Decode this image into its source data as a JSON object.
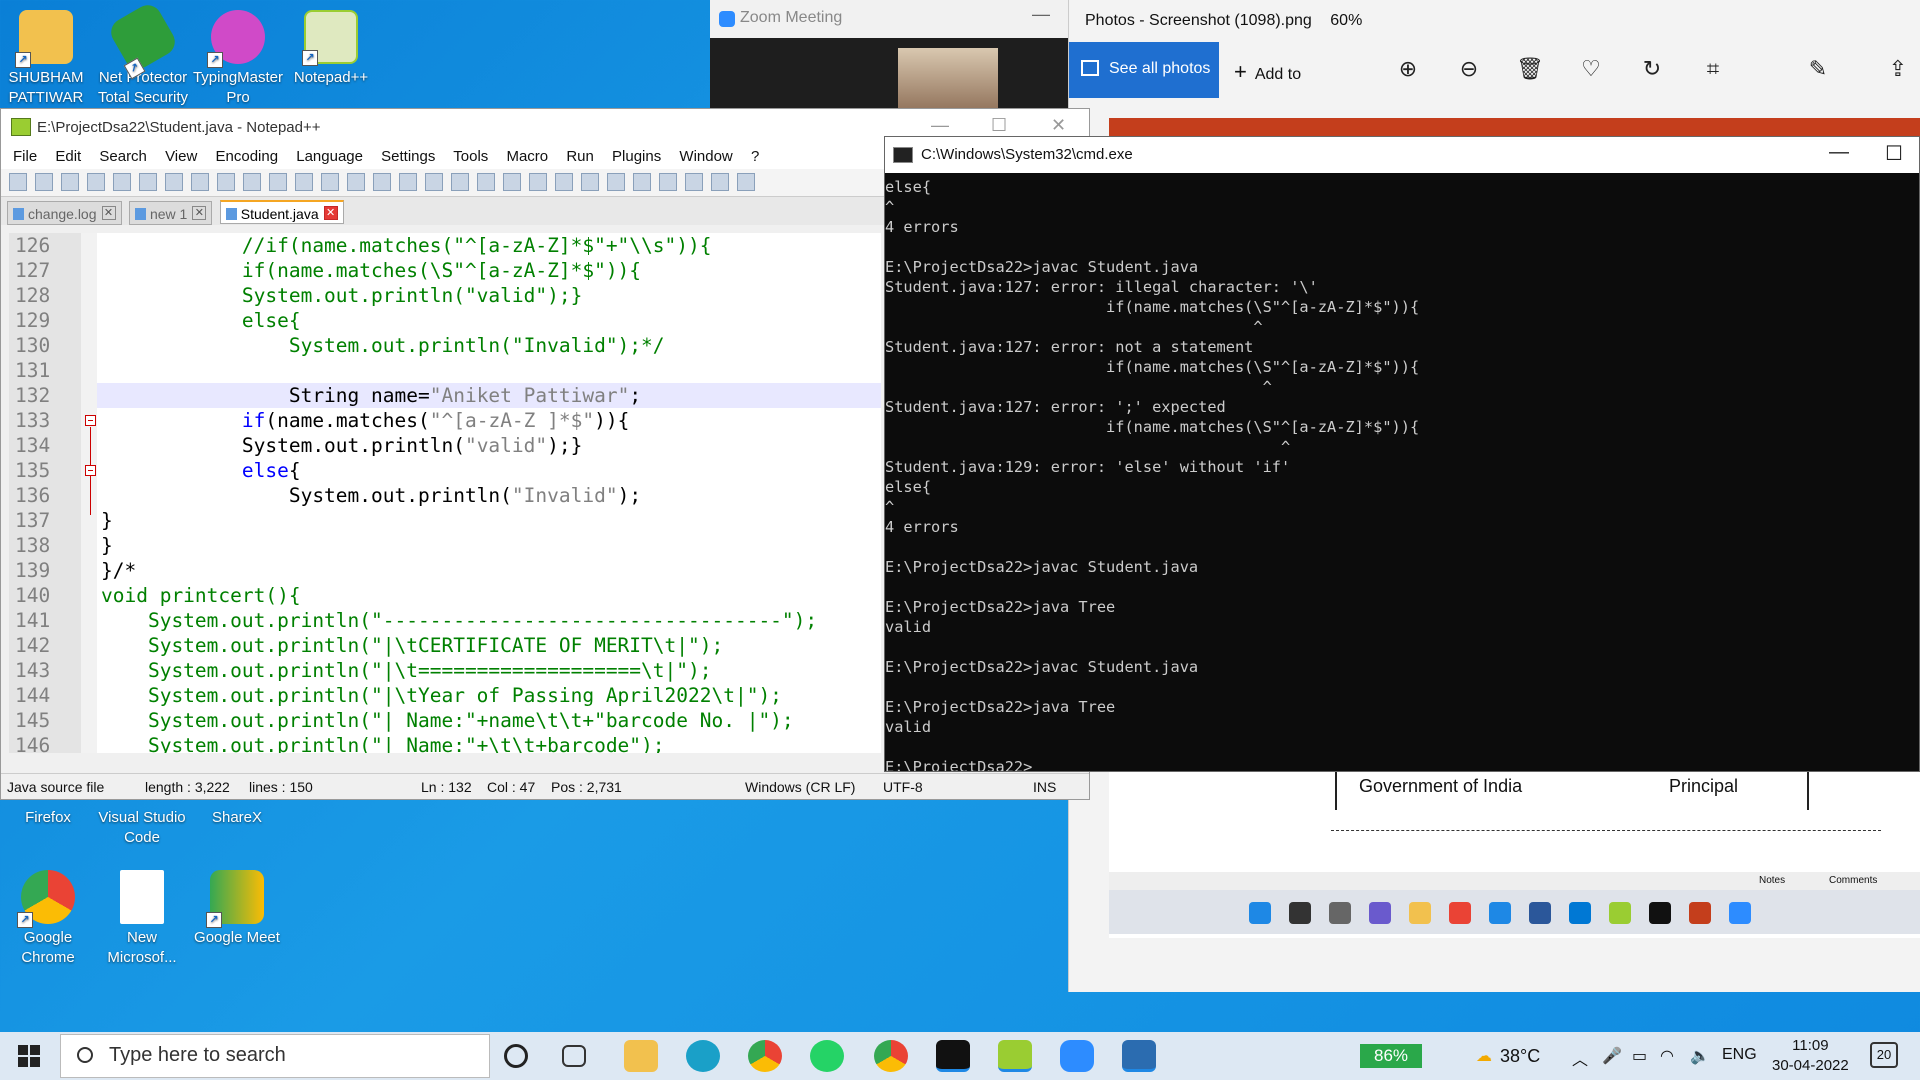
{
  "desktop": {
    "icons_top": [
      {
        "label": "SHUBHAM PATTIWAR",
        "icon": "user-folder-icon",
        "color": "#f2c14e"
      },
      {
        "label": "Net Protector Total Security",
        "icon": "shield-icon",
        "color": "#2e9d3a"
      },
      {
        "label": "TypingMaster Pro",
        "icon": "typingmaster-icon",
        "color": "#d04ac8"
      },
      {
        "label": "Notepad++",
        "icon": "notepadpp-icon",
        "color": "#9acd32"
      }
    ],
    "icons_bottom": [
      {
        "label": "Firefox",
        "icon": "firefox-icon"
      },
      {
        "label": "Visual Studio Code",
        "icon": "vscode-icon"
      },
      {
        "label": "ShareX",
        "icon": "sharex-icon"
      },
      {
        "label": "Google Chrome",
        "icon": "chrome-icon"
      },
      {
        "label": "New Microsof...",
        "icon": "word-doc-icon"
      },
      {
        "label": "Google Meet",
        "icon": "google-meet-icon"
      }
    ]
  },
  "zoom": {
    "title": "Zoom Meeting",
    "minimize": "—"
  },
  "photos": {
    "title": "Photos - Screenshot (1098).png",
    "zoom_level": "60%",
    "see_all": "See all photos",
    "add_to": "Add to",
    "toolbar_icons": [
      "zoom-in-icon",
      "zoom-out-icon",
      "delete-icon",
      "favorite-icon",
      "rotate-icon",
      "crop-icon",
      "edit-icon",
      "share-icon"
    ],
    "cert_left": "Government of India",
    "cert_right": "Principal",
    "notes": "Notes",
    "comments": "Comments"
  },
  "notepadpp": {
    "title": "E:\\ProjectDsa22\\Student.java - Notepad++",
    "menu": [
      "File",
      "Edit",
      "Search",
      "View",
      "Encoding",
      "Language",
      "Settings",
      "Tools",
      "Macro",
      "Run",
      "Plugins",
      "Window",
      "?"
    ],
    "tabs": [
      {
        "label": "change.log",
        "active": false
      },
      {
        "label": "new 1",
        "active": false
      },
      {
        "label": "Student.java",
        "active": true
      }
    ],
    "lines": [
      {
        "n": "126",
        "parts": [
          {
            "t": "            //if(name.matches(\"^[a-zA-Z]*$\"+\"\\\\s\")){",
            "c": "cm"
          }
        ]
      },
      {
        "n": "127",
        "parts": [
          {
            "t": "            if(name.matches(\\S\"^[a-zA-Z]*$\")){",
            "c": "cm"
          }
        ]
      },
      {
        "n": "128",
        "parts": [
          {
            "t": "            System.out.println(\"valid\");}",
            "c": "cm"
          }
        ]
      },
      {
        "n": "129",
        "parts": [
          {
            "t": "            else{",
            "c": "cm"
          }
        ]
      },
      {
        "n": "130",
        "parts": [
          {
            "t": "                System.out.println(\"Invalid\");*/",
            "c": "cm"
          }
        ]
      },
      {
        "n": "131",
        "parts": [
          {
            "t": "",
            "c": "pl"
          }
        ]
      },
      {
        "n": "132",
        "parts": [
          {
            "t": "                String name=",
            "c": "pl"
          },
          {
            "t": "\"Aniket Pattiwar\"",
            "c": "st"
          },
          {
            "t": ";",
            "c": "pl"
          }
        ]
      },
      {
        "n": "133",
        "parts": [
          {
            "t": "            ",
            "c": "pl"
          },
          {
            "t": "if",
            "c": "kw"
          },
          {
            "t": "(name.matches(",
            "c": "pl"
          },
          {
            "t": "\"^[a-zA-Z ]*$\"",
            "c": "st"
          },
          {
            "t": ")){",
            "c": "pl"
          }
        ]
      },
      {
        "n": "134",
        "parts": [
          {
            "t": "            System.out.println(",
            "c": "pl"
          },
          {
            "t": "\"valid\"",
            "c": "st"
          },
          {
            "t": ");}",
            "c": "pl"
          }
        ]
      },
      {
        "n": "135",
        "parts": [
          {
            "t": "            ",
            "c": "pl"
          },
          {
            "t": "else",
            "c": "kw"
          },
          {
            "t": "{",
            "c": "pl"
          }
        ]
      },
      {
        "n": "136",
        "parts": [
          {
            "t": "                System.out.println(",
            "c": "pl"
          },
          {
            "t": "\"Invalid\"",
            "c": "st"
          },
          {
            "t": ");",
            "c": "pl"
          }
        ]
      },
      {
        "n": "137",
        "parts": [
          {
            "t": "}",
            "c": "pl"
          }
        ]
      },
      {
        "n": "138",
        "parts": [
          {
            "t": "}",
            "c": "pl"
          }
        ]
      },
      {
        "n": "139",
        "parts": [
          {
            "t": "}/*",
            "c": "pl"
          }
        ]
      },
      {
        "n": "140",
        "parts": [
          {
            "t": "void printcert(){",
            "c": "cm"
          }
        ]
      },
      {
        "n": "141",
        "parts": [
          {
            "t": "    System.out.println(\"----------------------------------\");",
            "c": "cm"
          }
        ]
      },
      {
        "n": "142",
        "parts": [
          {
            "t": "    System.out.println(\"|\\tCERTIFICATE OF MERIT\\t|\");",
            "c": "cm"
          }
        ]
      },
      {
        "n": "143",
        "parts": [
          {
            "t": "    System.out.println(\"|\\t===================\\t|\");",
            "c": "cm"
          }
        ]
      },
      {
        "n": "144",
        "parts": [
          {
            "t": "    System.out.println(\"|\\tYear of Passing April2022\\t|\");",
            "c": "cm"
          }
        ]
      },
      {
        "n": "145",
        "parts": [
          {
            "t": "    System.out.println(\"| Name:\"+name\\t\\t+\"barcode No. |\");",
            "c": "cm"
          }
        ]
      },
      {
        "n": "146",
        "parts": [
          {
            "t": "    System.out.println(\"| Name:\"+\\t\\t+barcode\");",
            "c": "cm"
          }
        ]
      }
    ],
    "status": {
      "type": "Java source file",
      "length": "length : 3,222",
      "lines": "lines : 150",
      "ln": "Ln : 132",
      "col": "Col : 47",
      "pos": "Pos : 2,731",
      "eol": "Windows (CR LF)",
      "enc": "UTF-8",
      "mode": "INS"
    }
  },
  "cmd": {
    "title": "C:\\Windows\\System32\\cmd.exe",
    "output": "else{\n^\n4 errors\n\nE:\\ProjectDsa22>javac Student.java\nStudent.java:127: error: illegal character: '\\'\n                        if(name.matches(\\S\"^[a-zA-Z]*$\")){\n                                        ^\nStudent.java:127: error: not a statement\n                        if(name.matches(\\S\"^[a-zA-Z]*$\")){\n                                         ^\nStudent.java:127: error: ';' expected\n                        if(name.matches(\\S\"^[a-zA-Z]*$\")){\n                                           ^\nStudent.java:129: error: 'else' without 'if'\nelse{\n^\n4 errors\n\nE:\\ProjectDsa22>javac Student.java\n\nE:\\ProjectDsa22>java Tree\nvalid\n\nE:\\ProjectDsa22>javac Student.java\n\nE:\\ProjectDsa22>java Tree\nvalid\n\nE:\\ProjectDsa22>"
  },
  "taskbar": {
    "search_placeholder": "Type here to search",
    "battery": "86%",
    "weather": "38°C",
    "lang": "ENG",
    "time": "11:09",
    "date": "30-04-2022",
    "notifications": "20",
    "apps": [
      "task-view-icon",
      "widgets-icon",
      "file-explorer-icon",
      "edge-icon",
      "chrome-icon",
      "whatsapp-icon",
      "chrome-profile-icon",
      "terminal-icon",
      "notepadpp-icon",
      "zoom-icon",
      "photos-icon"
    ]
  }
}
